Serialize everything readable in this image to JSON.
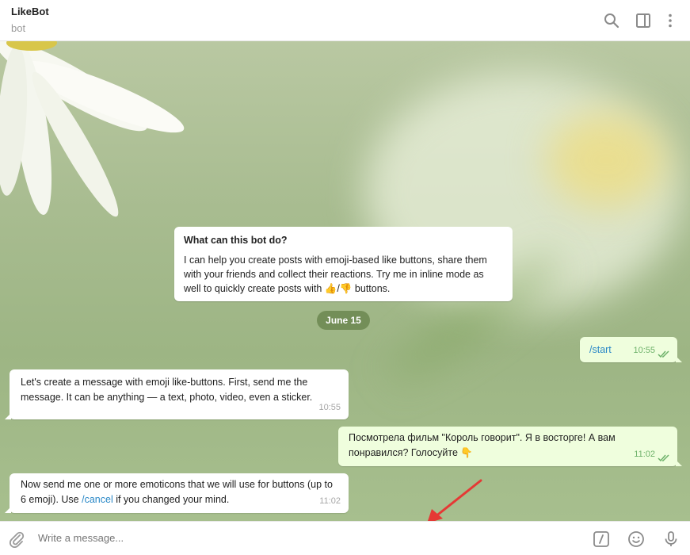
{
  "header": {
    "title": "LikeBot",
    "subtitle": "bot",
    "icons": [
      "search-icon",
      "sidebar-toggle-icon",
      "more-vertical-icon"
    ]
  },
  "bot_info": {
    "title": "What can this bot do?",
    "text": "I can help you create posts with emoji-based like buttons, share them with your friends and collect their reactions. Try me in inline mode as well to quickly create posts with 👍/👎 buttons."
  },
  "date_separator": "June 15",
  "messages": [
    {
      "direction": "out",
      "text_link": "/start",
      "time": "10:55",
      "read": true
    },
    {
      "direction": "in",
      "text": "Let's create a message with emoji like-buttons. First, send me the message. It can be anything — a text, photo, video, even a sticker.",
      "time": "10:55"
    },
    {
      "direction": "out",
      "text": "Посмотрела фильм \"Король говорит\". Я в восторге! А вам понравился? Голосуйте 👇",
      "time": "11:02",
      "read": true
    },
    {
      "direction": "in",
      "text_before": "Now send me one or more emoticons that we will use for buttons (up to 6 emoji). Use ",
      "text_link": "/cancel",
      "text_after": " if you changed your mind.",
      "time": "11:02"
    }
  ],
  "composer": {
    "placeholder": "Write a message...",
    "icons": [
      "attach-icon",
      "bot-commands-icon",
      "emoji-icon",
      "microphone-icon"
    ]
  },
  "colors": {
    "outgoing_bubble": "#effedd",
    "incoming_bubble": "#ffffff",
    "link": "#2a88c7",
    "read_check": "#6eb26a",
    "annotation_arrow": "#e53935"
  }
}
